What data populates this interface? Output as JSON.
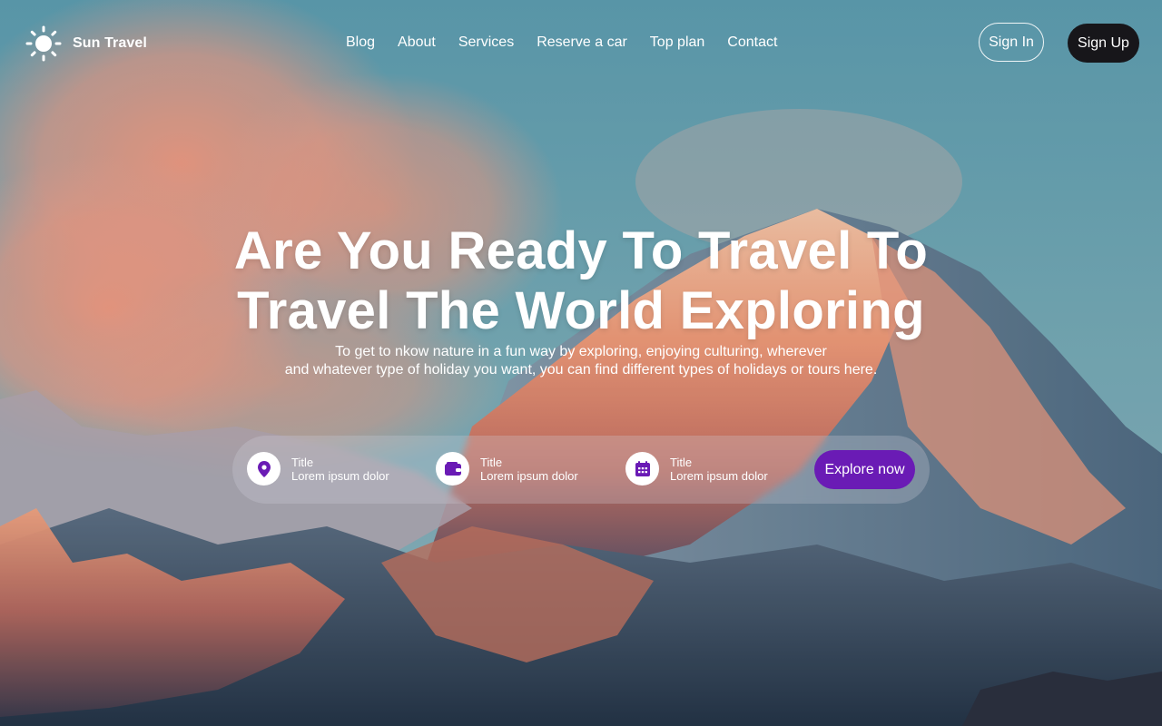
{
  "brand": {
    "name": "Sun Travel",
    "icon": "sun-icon"
  },
  "nav": {
    "items": [
      "Blog",
      "About",
      "Services",
      "Reserve a car",
      "Top plan",
      "Contact"
    ]
  },
  "auth": {
    "signin_label": "Sign In",
    "signup_label": "Sign Up"
  },
  "hero": {
    "title_line1": "Are You Ready To Travel To",
    "title_line2": "Travel The World Exploring",
    "subtitle_line1": "To get to nkow nature in a fun way by exploring, enjoying culturing, wherever",
    "subtitle_line2": "and whatever type of holiday you want, you can find different types of holidays or tours here."
  },
  "search": {
    "fields": [
      {
        "title": "Title",
        "value": "Lorem ipsum dolor",
        "icon": "location-pin-icon"
      },
      {
        "title": "Title",
        "value": "Lorem ipsum dolor",
        "icon": "wallet-icon"
      },
      {
        "title": "Title",
        "value": "Lorem ipsum dolor",
        "icon": "calendar-icon"
      }
    ],
    "button_label": "Explore now"
  },
  "colors": {
    "accent": "#6a1bb5",
    "signup_bg": "#17161a",
    "text": "#ffffff"
  }
}
